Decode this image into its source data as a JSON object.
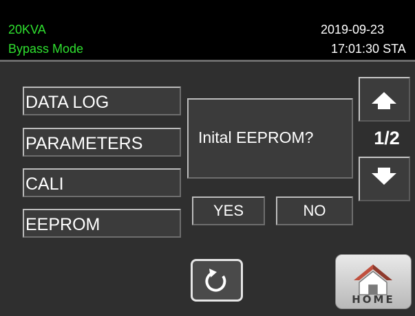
{
  "header": {
    "model": "20KVA",
    "mode": "Bypass Mode",
    "date": "2019-09-23",
    "time": "17:01:30 STA"
  },
  "menu": {
    "items": [
      {
        "label": "DATA LOG"
      },
      {
        "label": "PARAMETERS"
      },
      {
        "label": "CALI"
      },
      {
        "label": "EEPROM"
      }
    ]
  },
  "dialog": {
    "message": "Inital EEPROM?",
    "yes_label": "YES",
    "no_label": "NO"
  },
  "pager": {
    "indicator": "1/2",
    "up_icon": "arrow-up-icon",
    "down_icon": "arrow-down-icon"
  },
  "footer": {
    "refresh_icon": "refresh-icon",
    "home_label": "HOME"
  },
  "colors": {
    "header_text_green": "#2fe02f",
    "panel_background": "#2f2f2f",
    "text_white": "#ffffff"
  }
}
